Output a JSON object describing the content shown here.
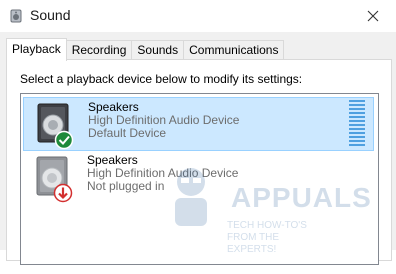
{
  "window": {
    "title": "Sound",
    "app_icon": "speaker-icon",
    "close_icon": "close-icon"
  },
  "tabs": [
    {
      "label": "Playback",
      "active": true
    },
    {
      "label": "Recording",
      "active": false
    },
    {
      "label": "Sounds",
      "active": false
    },
    {
      "label": "Communications",
      "active": false
    }
  ],
  "playback": {
    "instruction": "Select a playback device below to modify its settings:",
    "devices": [
      {
        "name": "Speakers",
        "description": "High Definition Audio Device",
        "status": "Default Device",
        "icon": "speaker-icon",
        "badge_icon": "green-check-icon",
        "selected": true
      },
      {
        "name": "Speakers",
        "description": "High Definition Audio Device",
        "status": "Not plugged in",
        "icon": "speaker-icon",
        "badge_icon": "red-down-arrow-icon",
        "selected": false
      }
    ]
  },
  "watermark": {
    "brand": "APPUALS",
    "tagline": "TECH HOW-TO'S FROM THE EXPERTS!"
  },
  "colors": {
    "selection_bg": "#cce8ff",
    "selection_border": "#99d1ff",
    "meter": "#4fa0e0",
    "check_badge": "#1e8a3a",
    "down_badge": "#d32f2f"
  }
}
